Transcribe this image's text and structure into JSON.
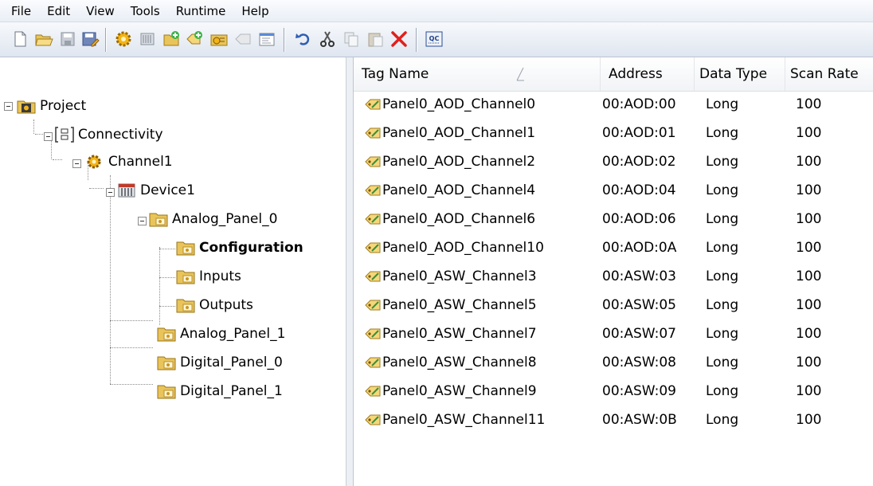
{
  "menu": [
    "File",
    "Edit",
    "View",
    "Tools",
    "Runtime",
    "Help"
  ],
  "toolbar": {
    "buttons": [
      {
        "name": "new-project-button",
        "icon": "new-document-icon"
      },
      {
        "name": "open-project-button",
        "icon": "folder-open-icon"
      },
      {
        "name": "save-button",
        "icon": "save-icon"
      },
      {
        "name": "save-as-button",
        "icon": "save-as-icon"
      },
      {
        "name": "new-channel-button",
        "icon": "gear-icon"
      },
      {
        "name": "new-device-button",
        "icon": "device-icon"
      },
      {
        "name": "new-tag-group-button",
        "icon": "tag-group-icon"
      },
      {
        "name": "new-tag-button",
        "icon": "tag-icon"
      },
      {
        "name": "bulk-tag-button",
        "icon": "bulk-tag-icon"
      },
      {
        "name": "duplicate-button",
        "icon": "duplicate-icon"
      },
      {
        "name": "properties-button",
        "icon": "properties-icon"
      },
      {
        "name": "undo-button",
        "icon": "undo-icon"
      },
      {
        "name": "cut-button",
        "icon": "cut-icon"
      },
      {
        "name": "copy-button",
        "icon": "copy-icon"
      },
      {
        "name": "paste-button",
        "icon": "paste-icon"
      },
      {
        "name": "delete-button",
        "icon": "delete-icon"
      },
      {
        "name": "quick-client-button",
        "icon": "quick-client-icon",
        "label": "QC"
      }
    ]
  },
  "tree": [
    {
      "label": "Project",
      "icon": "project-icon",
      "selected": false
    },
    {
      "label": "Connectivity",
      "icon": "connectivity-icon",
      "selected": false
    },
    {
      "label": "Channel1",
      "icon": "gear-icon",
      "selected": false
    },
    {
      "label": "Device1",
      "icon": "device-icon",
      "selected": false
    },
    {
      "label": "Analog_Panel_0",
      "icon": "folder-icon",
      "selected": false
    },
    {
      "label": "Configuration",
      "icon": "folder-icon",
      "selected": true
    },
    {
      "label": "Inputs",
      "icon": "folder-icon",
      "selected": false
    },
    {
      "label": "Outputs",
      "icon": "folder-icon",
      "selected": false
    },
    {
      "label": "Analog_Panel_1",
      "icon": "folder-icon",
      "selected": false
    },
    {
      "label": "Digital_Panel_0",
      "icon": "folder-icon",
      "selected": false
    },
    {
      "label": "Digital_Panel_1",
      "icon": "folder-icon",
      "selected": false
    }
  ],
  "table": {
    "columns": [
      "Tag Name",
      "Address",
      "Data Type",
      "Scan Rate"
    ],
    "rows": [
      [
        "Panel0_AOD_Channel0",
        "00:AOD:00",
        "Long",
        "100"
      ],
      [
        "Panel0_AOD_Channel1",
        "00:AOD:01",
        "Long",
        "100"
      ],
      [
        "Panel0_AOD_Channel2",
        "00:AOD:02",
        "Long",
        "100"
      ],
      [
        "Panel0_AOD_Channel4",
        "00:AOD:04",
        "Long",
        "100"
      ],
      [
        "Panel0_AOD_Channel6",
        "00:AOD:06",
        "Long",
        "100"
      ],
      [
        "Panel0_AOD_Channel10",
        "00:AOD:0A",
        "Long",
        "100"
      ],
      [
        "Panel0_ASW_Channel3",
        "00:ASW:03",
        "Long",
        "100"
      ],
      [
        "Panel0_ASW_Channel5",
        "00:ASW:05",
        "Long",
        "100"
      ],
      [
        "Panel0_ASW_Channel7",
        "00:ASW:07",
        "Long",
        "100"
      ],
      [
        "Panel0_ASW_Channel8",
        "00:ASW:08",
        "Long",
        "100"
      ],
      [
        "Panel0_ASW_Channel9",
        "00:ASW:09",
        "Long",
        "100"
      ],
      [
        "Panel0_ASW_Channel11",
        "00:ASW:0B",
        "Long",
        "100"
      ]
    ]
  },
  "colors": {
    "folder": "#e8c45a",
    "gear": "#f2b418",
    "delete": "#e0201c",
    "accent": "#3a6fc4"
  }
}
